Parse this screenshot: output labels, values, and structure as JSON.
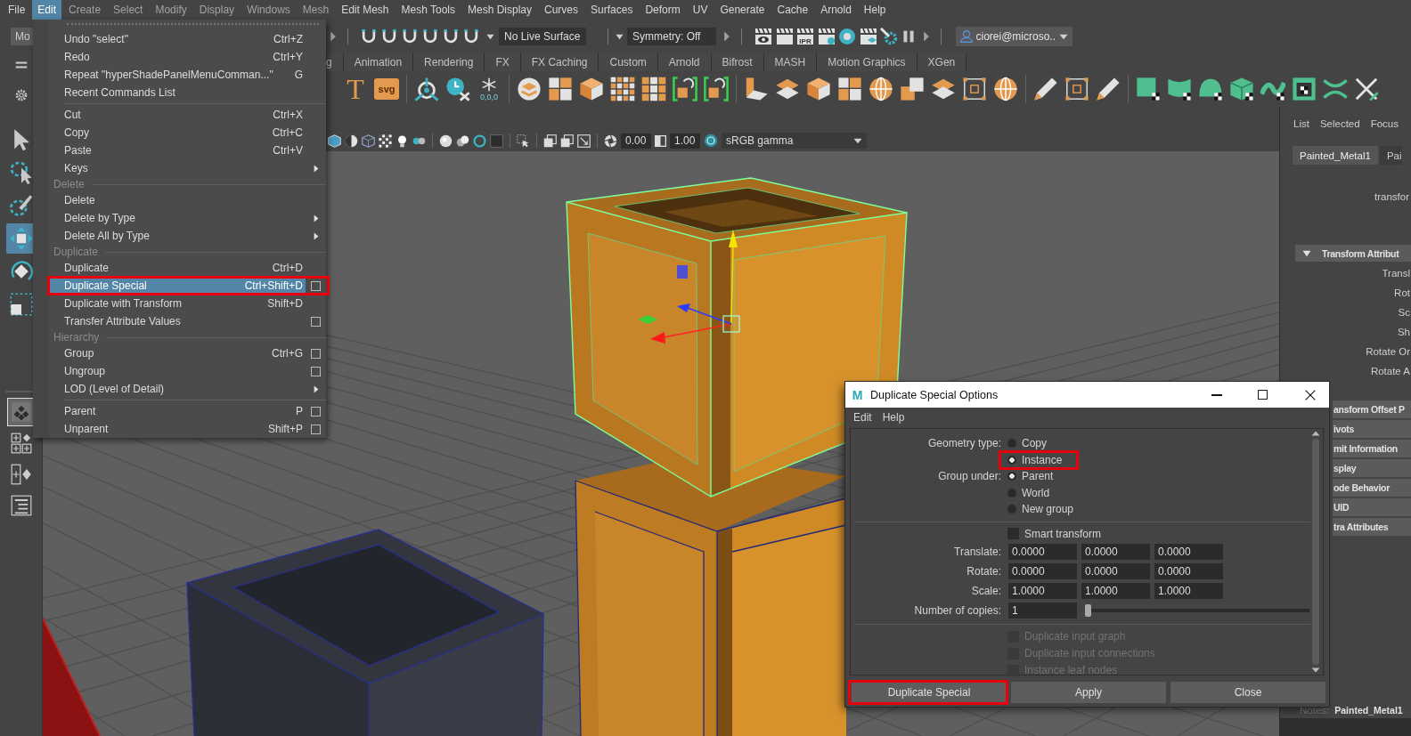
{
  "menu_bar": [
    {
      "label": "File",
      "selected": false,
      "dimmed": false
    },
    {
      "label": "Edit",
      "selected": true,
      "dimmed": false
    },
    {
      "label": "Create",
      "selected": false,
      "dimmed": true
    },
    {
      "label": "Select",
      "selected": false,
      "dimmed": true
    },
    {
      "label": "Modify",
      "selected": false,
      "dimmed": true
    },
    {
      "label": "Display",
      "selected": false,
      "dimmed": true
    },
    {
      "label": "Windows",
      "selected": false,
      "dimmed": true
    },
    {
      "label": "Mesh",
      "selected": false,
      "dimmed": true
    },
    {
      "label": "Edit Mesh",
      "selected": false,
      "dimmed": false
    },
    {
      "label": "Mesh Tools",
      "selected": false,
      "dimmed": false
    },
    {
      "label": "Mesh Display",
      "selected": false,
      "dimmed": false
    },
    {
      "label": "Curves",
      "selected": false,
      "dimmed": false
    },
    {
      "label": "Surfaces",
      "selected": false,
      "dimmed": false
    },
    {
      "label": "Deform",
      "selected": false,
      "dimmed": false
    },
    {
      "label": "UV",
      "selected": false,
      "dimmed": false
    },
    {
      "label": "Generate",
      "selected": false,
      "dimmed": false
    },
    {
      "label": "Cache",
      "selected": false,
      "dimmed": false
    },
    {
      "label": "Arnold",
      "selected": false,
      "dimmed": false
    },
    {
      "label": "Help",
      "selected": false,
      "dimmed": false
    }
  ],
  "status_line": {
    "mode": "Mo",
    "live_surface": "No Live Surface",
    "symmetry": "Symmetry: Off",
    "render_badge": "IPR",
    "user": "ciorei@microso.."
  },
  "shelf": {
    "tabs": [
      "g",
      "Animation",
      "Rendering",
      "FX",
      "FX Caching",
      "Custom",
      "Arnold",
      "Bifrost",
      "MASH",
      "Motion Graphics",
      "XGen"
    ],
    "text_buttons": [
      {
        "kind": "letter",
        "label": "T"
      },
      {
        "kind": "badge",
        "label": "svg"
      }
    ],
    "origin_reading": "0,0,0"
  },
  "toolbox": {
    "tools": [
      {
        "selected": false
      },
      {
        "selected": false
      },
      {
        "selected": false
      },
      {
        "selected": true
      },
      {
        "selected": false
      },
      {
        "selected": false
      }
    ],
    "layouts": [
      {
        "selected": true
      },
      {
        "selected": false
      },
      {
        "selected": false
      },
      {
        "selected": false
      }
    ]
  },
  "viewport_toolbar": {
    "exposure": "0.00",
    "gamma": "1.00",
    "color_space": "sRGB gamma"
  },
  "edit_menu": {
    "sections": [
      {
        "items": [
          {
            "label": "Undo \"select\"",
            "shortcut": "Ctrl+Z",
            "submenu": false,
            "option_box": false,
            "selected": false,
            "annotated": false
          },
          {
            "label": "Redo",
            "shortcut": "Ctrl+Y",
            "submenu": false,
            "option_box": false,
            "selected": false,
            "annotated": false
          },
          {
            "label": "Repeat \"hyperShadePanelMenuComman...\"",
            "shortcut": "G",
            "submenu": false,
            "option_box": false,
            "selected": false,
            "annotated": false
          },
          {
            "label": "Recent Commands List",
            "submenu": false,
            "option_box": false,
            "selected": false,
            "annotated": false
          }
        ]
      },
      {
        "items": [
          {
            "label": "Cut",
            "shortcut": "Ctrl+X",
            "submenu": false,
            "option_box": false,
            "selected": false,
            "annotated": false
          },
          {
            "label": "Copy",
            "shortcut": "Ctrl+C",
            "submenu": false,
            "option_box": false,
            "selected": false,
            "annotated": false
          },
          {
            "label": "Paste",
            "shortcut": "Ctrl+V",
            "submenu": false,
            "option_box": false,
            "selected": false,
            "annotated": false
          },
          {
            "label": "Keys",
            "submenu": true,
            "option_box": false,
            "selected": false,
            "annotated": false
          }
        ]
      },
      {
        "title": "Delete",
        "items": [
          {
            "label": "Delete",
            "submenu": false,
            "option_box": false,
            "selected": false,
            "annotated": false
          },
          {
            "label": "Delete by Type",
            "submenu": true,
            "option_box": false,
            "selected": false,
            "annotated": false
          },
          {
            "label": "Delete All by Type",
            "submenu": true,
            "option_box": false,
            "selected": false,
            "annotated": false
          }
        ]
      },
      {
        "title": "Duplicate",
        "items": [
          {
            "label": "Duplicate",
            "shortcut": "Ctrl+D",
            "submenu": false,
            "option_box": false,
            "selected": false,
            "annotated": false
          },
          {
            "label": "Duplicate Special",
            "shortcut": "Ctrl+Shift+D",
            "submenu": false,
            "option_box": true,
            "selected": true,
            "annotated": true
          },
          {
            "label": "Duplicate with Transform",
            "shortcut": "Shift+D",
            "submenu": false,
            "option_box": false,
            "selected": false,
            "annotated": false
          },
          {
            "label": "Transfer Attribute Values",
            "submenu": false,
            "option_box": true,
            "selected": false,
            "annotated": false
          }
        ]
      },
      {
        "title": "Hierarchy",
        "items": [
          {
            "label": "Group",
            "shortcut": "Ctrl+G",
            "submenu": false,
            "option_box": true,
            "selected": false,
            "annotated": false
          },
          {
            "label": "Ungroup",
            "submenu": false,
            "option_box": true,
            "selected": false,
            "annotated": false
          },
          {
            "label": "LOD (Level of Detail)",
            "submenu": true,
            "option_box": false,
            "selected": false,
            "annotated": false
          }
        ]
      },
      {
        "items": [
          {
            "label": "Parent",
            "shortcut": "P",
            "submenu": false,
            "option_box": true,
            "selected": false,
            "annotated": false
          },
          {
            "label": "Unparent",
            "shortcut": "Shift+P",
            "submenu": false,
            "option_box": true,
            "selected": false,
            "annotated": false
          }
        ]
      }
    ]
  },
  "dialog": {
    "logo": "M",
    "title": "Duplicate Special Options",
    "menu": [
      "Edit",
      "Help"
    ],
    "geometry_type": {
      "label": "Geometry type:",
      "options": [
        {
          "label": "Copy",
          "selected": false,
          "annotated": false
        },
        {
          "label": "Instance",
          "selected": true,
          "annotated": true
        }
      ]
    },
    "group_under": {
      "label": "Group under:",
      "options": [
        {
          "label": "Parent",
          "selected": true,
          "annotated": false
        },
        {
          "label": "World",
          "selected": false,
          "annotated": false
        },
        {
          "label": "New group",
          "selected": false,
          "annotated": false
        }
      ]
    },
    "smart_transform": {
      "label": "Smart transform",
      "checked": false
    },
    "vectors": [
      {
        "label": "Translate:",
        "values": [
          "0.0000",
          "0.0000",
          "0.0000"
        ]
      },
      {
        "label": "Rotate:",
        "values": [
          "0.0000",
          "0.0000",
          "0.0000"
        ]
      },
      {
        "label": "Scale:",
        "values": [
          "1.0000",
          "1.0000",
          "1.0000"
        ]
      }
    ],
    "copies": {
      "label": "Number of copies:",
      "value": "1",
      "level": 0
    },
    "options": [
      {
        "label": "Duplicate input graph",
        "checked": false,
        "disabled": true
      },
      {
        "label": "Duplicate input connections",
        "checked": false,
        "disabled": true
      },
      {
        "label": "Instance leaf nodes",
        "checked": false,
        "disabled": true
      }
    ],
    "buttons": [
      {
        "label": "Duplicate Special",
        "annotated": true
      },
      {
        "label": "Apply",
        "annotated": false
      },
      {
        "label": "Close",
        "annotated": false
      }
    ]
  },
  "attribute_editor": {
    "menu": [
      "List",
      "Selected",
      "Focus"
    ],
    "tabs": [
      {
        "label": "Painted_Metal1",
        "selected": true
      },
      {
        "label": "Pai",
        "selected": false
      }
    ],
    "node_type": "transfor",
    "section": {
      "title": "Transform Attribut",
      "expanded": true,
      "fields": [
        "Transl",
        "Rot",
        "Sc",
        "Sh",
        "Rotate Or",
        "Rotate A"
      ]
    },
    "collapsed_sections": [
      "ansform Offset P",
      "ivots",
      "mit Information",
      "splay",
      "ode Behavior",
      "UID",
      "tra Attributes"
    ],
    "notes_label": "Notes:",
    "notes": "Painted_Metal1"
  }
}
